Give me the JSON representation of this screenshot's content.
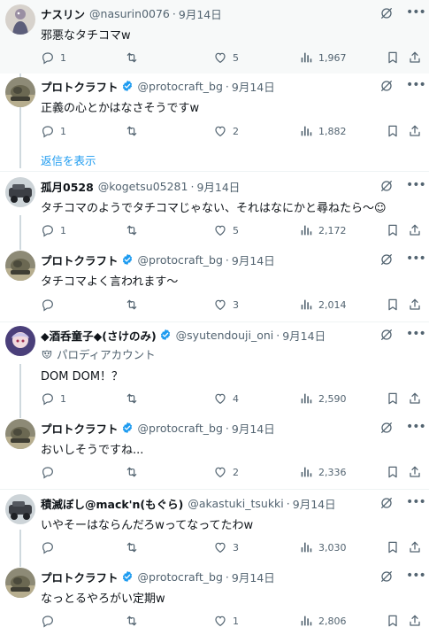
{
  "tweets": [
    {
      "name": "ナスリン",
      "handle": "@nasurin0076",
      "date": "9月14日",
      "verified": false,
      "text": "邪悪なタチコマw",
      "parody": "",
      "replies": "1",
      "retweets": "",
      "likes": "5",
      "views": "1,967",
      "avatar": "figure"
    },
    {
      "name": "プロトクラフト",
      "handle": "@protocraft_bg",
      "date": "9月14日",
      "verified": true,
      "text": "正義の心とかはなさそうですw",
      "parody": "",
      "replies": "1",
      "retweets": "",
      "likes": "2",
      "views": "1,882",
      "avatar": "tank"
    },
    {
      "name": "孤月0528",
      "handle": "@kogetsu05281",
      "date": "9月14日",
      "verified": false,
      "text": "タチコマのようでタチコマじゃない、それはなにかと尋ねたら～☺",
      "parody": "",
      "replies": "1",
      "retweets": "",
      "likes": "5",
      "views": "2,172",
      "avatar": "vehicle"
    },
    {
      "name": "プロトクラフト",
      "handle": "@protocraft_bg",
      "date": "9月14日",
      "verified": true,
      "text": "タチコマよく言われます～",
      "parody": "",
      "replies": "",
      "retweets": "",
      "likes": "3",
      "views": "2,014",
      "avatar": "tank"
    },
    {
      "name": "◆酒呑童子◆(さけのみ)",
      "handle": "@syutendouji_oni",
      "date": "9月14日",
      "verified": true,
      "text": "DOM DOM！？",
      "parody": "パロディアカウント",
      "replies": "1",
      "retweets": "",
      "likes": "4",
      "views": "2,590",
      "avatar": "anime"
    },
    {
      "name": "プロトクラフト",
      "handle": "@protocraft_bg",
      "date": "9月14日",
      "verified": true,
      "text": "おいしそうですね...",
      "parody": "",
      "replies": "",
      "retweets": "",
      "likes": "2",
      "views": "2,336",
      "avatar": "tank"
    },
    {
      "name": "積滅ぼし@mack'n(もぐら)",
      "handle": "@akastuki_tsukki",
      "date": "9月14日",
      "verified": false,
      "text": "いやそーはならんだろwってなってたわw",
      "parody": "",
      "replies": "",
      "retweets": "",
      "likes": "3",
      "views": "3,030",
      "avatar": "vehicle"
    },
    {
      "name": "プロトクラフト",
      "handle": "@protocraft_bg",
      "date": "9月14日",
      "verified": true,
      "text": "なっとるやろがい定期w",
      "parody": "",
      "replies": "",
      "retweets": "",
      "likes": "1",
      "views": "2,806",
      "avatar": "tank"
    }
  ],
  "show_replies_label": "返信を表示",
  "colors": {
    "accent": "#1d9bf0",
    "muted": "#536471",
    "text": "#0f1419",
    "highlight_bg": "#f7f9f9",
    "divider": "#eff3f4"
  },
  "icons": [
    "grok-icon",
    "more-icon",
    "reply-icon",
    "retweet-icon",
    "like-icon",
    "views-icon",
    "bookmark-icon",
    "share-icon",
    "verified-badge-icon",
    "parody-icon"
  ]
}
